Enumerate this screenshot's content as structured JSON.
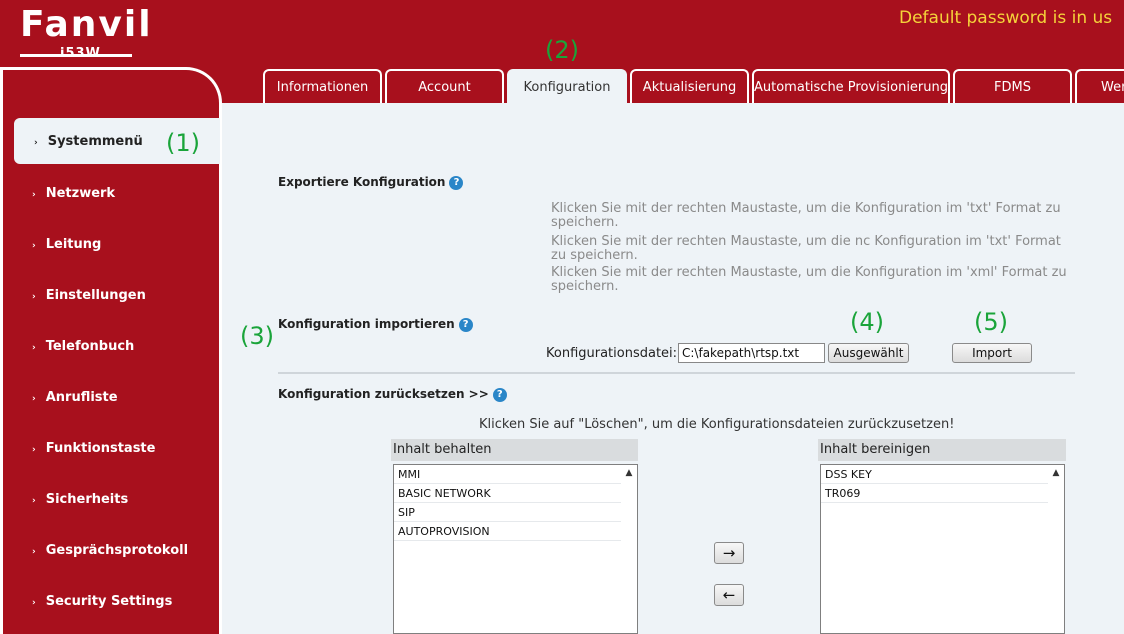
{
  "header": {
    "brand": "Fanvil",
    "model": "i53W",
    "default_password_notice": "Default password is in us"
  },
  "tabs": [
    {
      "label": "Informationen",
      "active": false
    },
    {
      "label": "Account",
      "active": false
    },
    {
      "label": "Konfiguration",
      "active": true
    },
    {
      "label": "Aktualisierung",
      "active": false
    },
    {
      "label": "Automatische Provisionierung",
      "active": false
    },
    {
      "label": "FDMS",
      "active": false
    },
    {
      "label": "Wer",
      "active": false
    }
  ],
  "sidebar": {
    "arrow_glyph": "›",
    "items": [
      {
        "label": "Systemmenü",
        "active": true
      },
      {
        "label": "Netzwerk",
        "active": false
      },
      {
        "label": "Leitung",
        "active": false
      },
      {
        "label": "Einstellungen",
        "active": false
      },
      {
        "label": "Telefonbuch",
        "active": false
      },
      {
        "label": "Anrufliste",
        "active": false
      },
      {
        "label": "Funktionstaste",
        "active": false
      },
      {
        "label": "Sicherheits",
        "active": false
      },
      {
        "label": "Gesprächsprotokoll",
        "active": false
      },
      {
        "label": "Security Settings",
        "active": false
      }
    ]
  },
  "annotations": [
    "(1)",
    "(2)",
    "(3)",
    "(4)",
    "(5)"
  ],
  "export": {
    "title": "Exportiere Konfiguration",
    "links": [
      "Klicken Sie mit der rechten Maustaste, um die Konfiguration im 'txt' Format zu speichern.",
      "Klicken Sie mit der rechten Maustaste, um die nc Konfiguration im 'txt' Format zu speichern.",
      "Klicken Sie mit der rechten Maustaste, um die Konfiguration im 'xml' Format zu speichern."
    ]
  },
  "import": {
    "title": "Konfiguration importieren",
    "file_label": "Konfigurationsdatei:",
    "file_value": "C:\\fakepath\\rtsp.txt",
    "choose_button": "Ausgewählt",
    "import_button": "Import"
  },
  "reset": {
    "title": "Konfiguration zurücksetzen >>",
    "hint": "Klicken Sie auf \"Löschen\", um die Konfigurationsdateien zurückzusetzen!",
    "keep_header": "Inhalt behalten",
    "keep_items": [
      "MMI",
      "BASIC NETWORK",
      "SIP",
      "AUTOPROVISION"
    ],
    "clear_header": "Inhalt bereinigen",
    "clear_items": [
      "DSS KEY",
      "TR069"
    ],
    "move_right": "→",
    "move_left": "←"
  },
  "icons": {
    "help": "?",
    "scroll_up": "▲"
  },
  "colors": {
    "brand_red": "#a8101d",
    "notice_yellow": "#f5d33a",
    "annotation_green": "#1aa43a",
    "help_blue": "#2a86c8"
  }
}
